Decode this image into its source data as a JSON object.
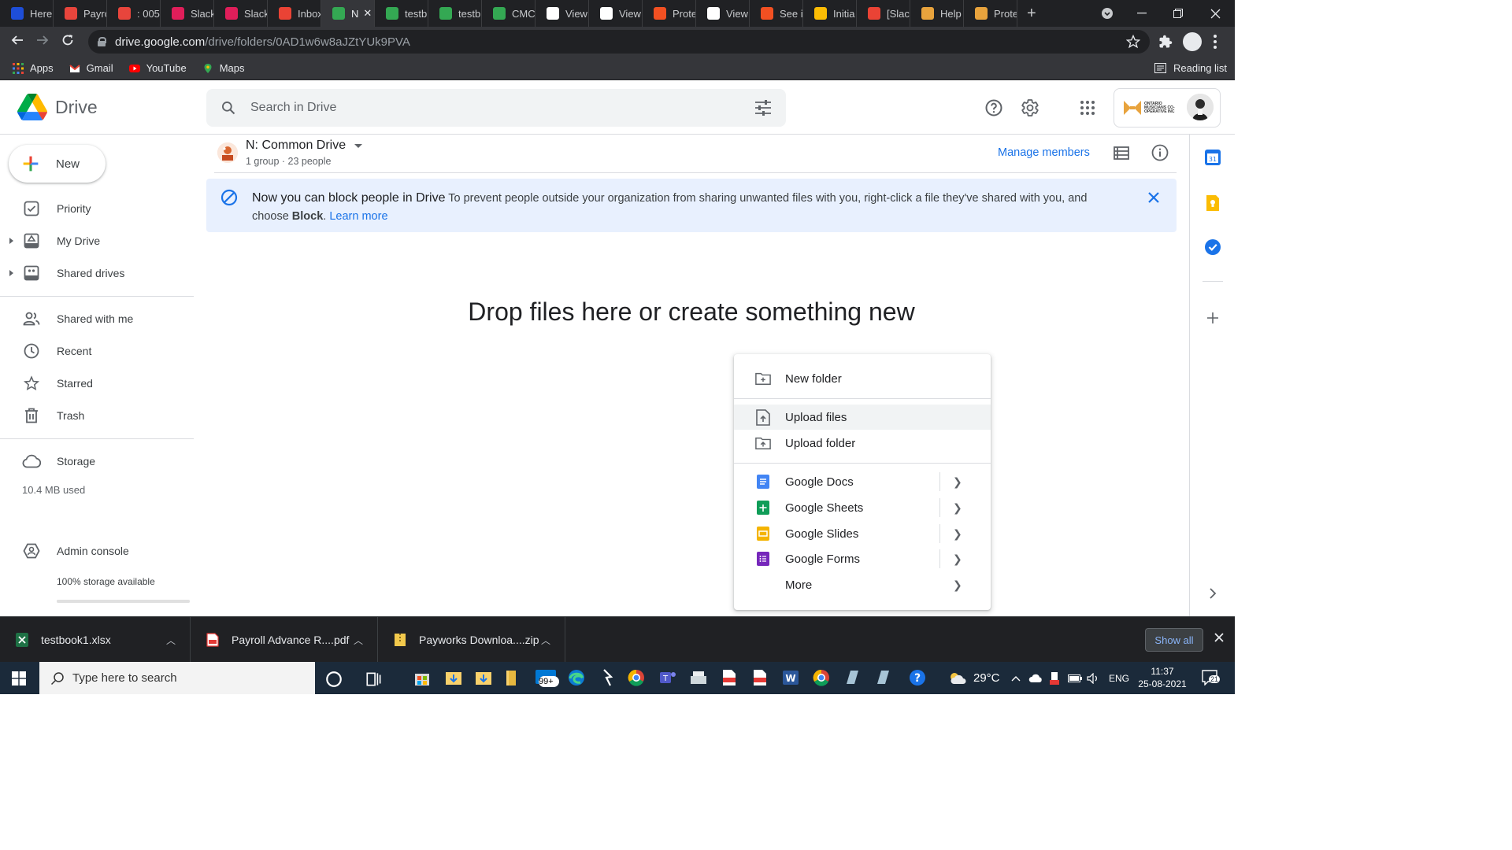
{
  "browser": {
    "tabs": [
      {
        "label": "Here",
        "color": "#1e4ed8"
      },
      {
        "label": "Payro",
        "color": "#e8453c"
      },
      {
        "label": ": 005",
        "color": "#e8453c"
      },
      {
        "label": "Slack",
        "color": "#e01e5a"
      },
      {
        "label": "Slack",
        "color": "#e01e5a"
      },
      {
        "label": "Inbox",
        "color": "#ea4335"
      },
      {
        "label": "N",
        "color": "#34a853",
        "active": true
      },
      {
        "label": "testb",
        "color": "#34a853"
      },
      {
        "label": "testb",
        "color": "#34a853"
      },
      {
        "label": "CMC",
        "color": "#34a853"
      },
      {
        "label": "View",
        "color": "#ffffff"
      },
      {
        "label": "View",
        "color": "#ffffff"
      },
      {
        "label": "Prote",
        "color": "#f25022"
      },
      {
        "label": "View",
        "color": "#ffffff"
      },
      {
        "label": "See i",
        "color": "#f25022"
      },
      {
        "label": "Initia",
        "color": "#fbbc04"
      },
      {
        "label": "[Slac",
        "color": "#ea4335"
      },
      {
        "label": "Help",
        "color": "#e8a33d"
      },
      {
        "label": "Prote",
        "color": "#e8a33d"
      }
    ],
    "url_host": "drive.google.com",
    "url_path": "/drive/folders/0AD1w6w8aJZtYUk9PVA",
    "bookmarks": [
      "Apps",
      "Gmail",
      "YouTube",
      "Maps"
    ],
    "reading_list": "Reading list"
  },
  "drive": {
    "app_name": "Drive",
    "search_placeholder": "Search in Drive",
    "org_name": "ONTARIO MUSICIANS CO-OPERATIVE INC"
  },
  "sidebar": {
    "new_label": "New",
    "items": [
      {
        "label": "Priority"
      },
      {
        "label": "My Drive"
      },
      {
        "label": "Shared drives"
      },
      {
        "label": "Shared with me"
      },
      {
        "label": "Recent"
      },
      {
        "label": "Starred"
      },
      {
        "label": "Trash"
      },
      {
        "label": "Storage"
      },
      {
        "label": "Admin console"
      }
    ],
    "storage_used": "10.4 MB used",
    "storage_available": "100% storage available",
    "storage_available_fraction": 1.0
  },
  "main": {
    "drive_title": "N: Common Drive",
    "drive_subtitle": "1 group · 23 people",
    "manage_members": "Manage members",
    "banner": {
      "title": "Now you can block people in Drive",
      "body": "To prevent people outside your organization from sharing unwanted files with you, right-click a file they've shared with you, and choose",
      "bold": "Block",
      "period": ".",
      "link": "Learn more"
    },
    "drop_hint": "Drop files here or create something new"
  },
  "menu": {
    "items": [
      {
        "label": "New folder"
      },
      {
        "label": "Upload files"
      },
      {
        "label": "Upload folder"
      },
      {
        "label": "Google Docs"
      },
      {
        "label": "Google Sheets"
      },
      {
        "label": "Google Slides"
      },
      {
        "label": "Google Forms"
      },
      {
        "label": "More"
      }
    ]
  },
  "downloads": {
    "items": [
      "testbook1.xlsx",
      "Payroll Advance R....pdf",
      "Payworks Downloa....zip"
    ],
    "show_all": "Show all"
  },
  "taskbar": {
    "search_placeholder": "Type here to search",
    "badge": "99+",
    "weather": "29°C",
    "lang": "ENG",
    "time": "11:37",
    "date": "25-08-2021",
    "notifications": "21"
  }
}
